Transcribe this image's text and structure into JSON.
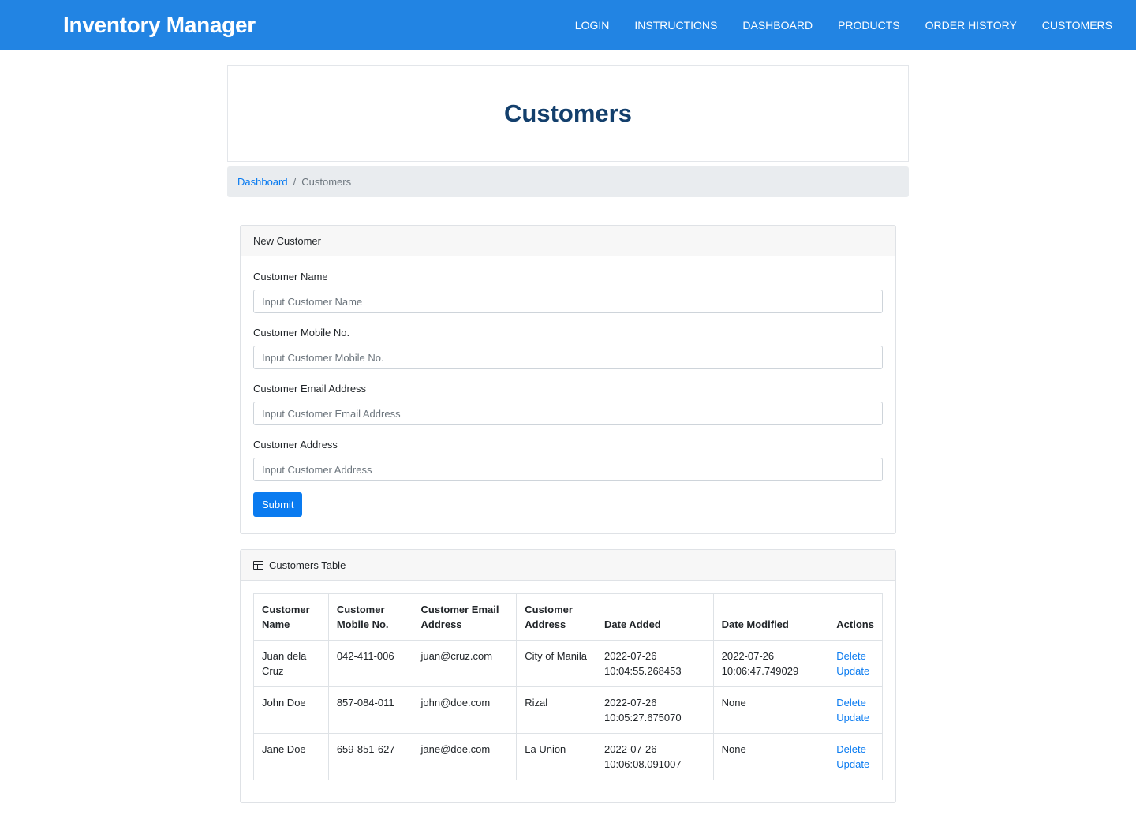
{
  "navbar": {
    "brand": "Inventory Manager",
    "links": [
      "LOGIN",
      "INSTRUCTIONS",
      "DASHBOARD",
      "PRODUCTS",
      "ORDER HISTORY",
      "CUSTOMERS"
    ]
  },
  "page": {
    "title": "Customers"
  },
  "breadcrumb": {
    "home": "Dashboard",
    "separator": "/",
    "current": "Customers"
  },
  "form": {
    "header": "New Customer",
    "fields": [
      {
        "label": "Customer Name",
        "placeholder": "Input Customer Name",
        "value": ""
      },
      {
        "label": "Customer Mobile No.",
        "placeholder": "Input Customer Mobile No.",
        "value": ""
      },
      {
        "label": "Customer Email Address",
        "placeholder": "Input Customer Email Address",
        "value": ""
      },
      {
        "label": "Customer Address",
        "placeholder": "Input Customer Address",
        "value": ""
      }
    ],
    "submit_label": "Submit"
  },
  "table": {
    "header": "Customers Table",
    "columns": [
      "Customer Name",
      "Customer Mobile No.",
      "Customer Email Address",
      "Customer Address",
      "Date Added",
      "Date Modified",
      "Actions"
    ],
    "rows": [
      {
        "name": "Juan dela Cruz",
        "mobile": "042-411-006",
        "email": "juan@cruz.com",
        "address": "City of Manila",
        "date_added": "2022-07-26 10:04:55.268453",
        "date_modified": "2022-07-26 10:06:47.749029",
        "delete": "Delete",
        "update": "Update"
      },
      {
        "name": "John Doe",
        "mobile": "857-084-011",
        "email": "john@doe.com",
        "address": "Rizal",
        "date_added": "2022-07-26 10:05:27.675070",
        "date_modified": "None",
        "delete": "Delete",
        "update": "Update"
      },
      {
        "name": "Jane Doe",
        "mobile": "659-851-627",
        "email": "jane@doe.com",
        "address": "La Union",
        "date_added": "2022-07-26 10:06:08.091007",
        "date_modified": "None",
        "delete": "Delete",
        "update": "Update"
      }
    ]
  },
  "colors": {
    "navbar": "#2284e3",
    "title": "#133f6c",
    "link": "#0a7bf0",
    "breadcrumb_bg": "#e9ecef"
  },
  "icons": {
    "table_header": "table-icon"
  }
}
